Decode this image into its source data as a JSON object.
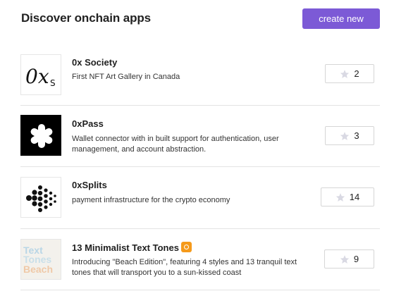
{
  "header": {
    "title": "Discover onchain apps",
    "create_label": "create new",
    "accent_color": "#7c5ad6"
  },
  "apps": [
    {
      "name": "0x Society",
      "description": "First NFT Art Gallery in Canada",
      "stars": "2",
      "icon": "0xs-logo-icon"
    },
    {
      "name": "0xPass",
      "description": "Wallet connector with in built support for authentication, user management, and account abstraction.",
      "stars": "3",
      "icon": "asterisk-logo-icon"
    },
    {
      "name": "0xSplits",
      "description": "payment infrastructure for the crypto economy",
      "stars": "14",
      "icon": "dots-logo-icon"
    },
    {
      "name": "13 Minimalist Text Tones",
      "description": "Introducing \"Beach Edition\", featuring 4 styles and 13 tranquil text tones that will transport you to a sun-kissed coast",
      "stars": "9",
      "icon": "text-tones-logo-icon",
      "icon_text": [
        "Text",
        "Tones",
        "Beach"
      ]
    }
  ]
}
